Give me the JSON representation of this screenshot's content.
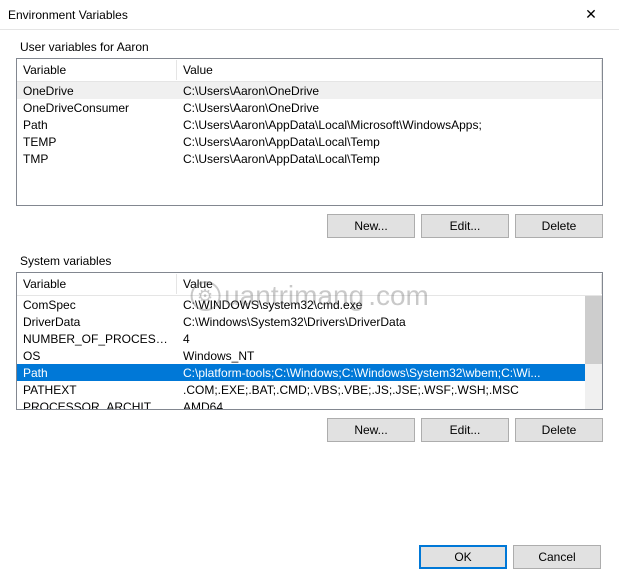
{
  "title": "Environment Variables",
  "user_section": {
    "label": "User variables for Aaron",
    "col_var": "Variable",
    "col_val": "Value",
    "rows": [
      {
        "var": "OneDrive",
        "val": "C:\\Users\\Aaron\\OneDrive"
      },
      {
        "var": "OneDriveConsumer",
        "val": "C:\\Users\\Aaron\\OneDrive"
      },
      {
        "var": "Path",
        "val": "C:\\Users\\Aaron\\AppData\\Local\\Microsoft\\WindowsApps;"
      },
      {
        "var": "TEMP",
        "val": "C:\\Users\\Aaron\\AppData\\Local\\Temp"
      },
      {
        "var": "TMP",
        "val": "C:\\Users\\Aaron\\AppData\\Local\\Temp"
      }
    ],
    "buttons": {
      "new": "New...",
      "edit": "Edit...",
      "delete": "Delete"
    }
  },
  "system_section": {
    "label": "System variables",
    "col_var": "Variable",
    "col_val": "Value",
    "rows": [
      {
        "var": "ComSpec",
        "val": "C:\\WINDOWS\\system32\\cmd.exe"
      },
      {
        "var": "DriverData",
        "val": "C:\\Windows\\System32\\Drivers\\DriverData"
      },
      {
        "var": "NUMBER_OF_PROCESSORS",
        "val": "4"
      },
      {
        "var": "OS",
        "val": "Windows_NT"
      },
      {
        "var": "Path",
        "val": "C:\\platform-tools;C:\\Windows;C:\\Windows\\System32\\wbem;C:\\Wi..."
      },
      {
        "var": "PATHEXT",
        "val": ".COM;.EXE;.BAT;.CMD;.VBS;.VBE;.JS;.JSE;.WSF;.WSH;.MSC"
      },
      {
        "var": "PROCESSOR_ARCHITECTURE",
        "val": "AMD64"
      }
    ],
    "selected_index": 4,
    "buttons": {
      "new": "New...",
      "edit": "Edit...",
      "delete": "Delete"
    }
  },
  "dialog_buttons": {
    "ok": "OK",
    "cancel": "Cancel"
  },
  "watermark": "uantrimang"
}
